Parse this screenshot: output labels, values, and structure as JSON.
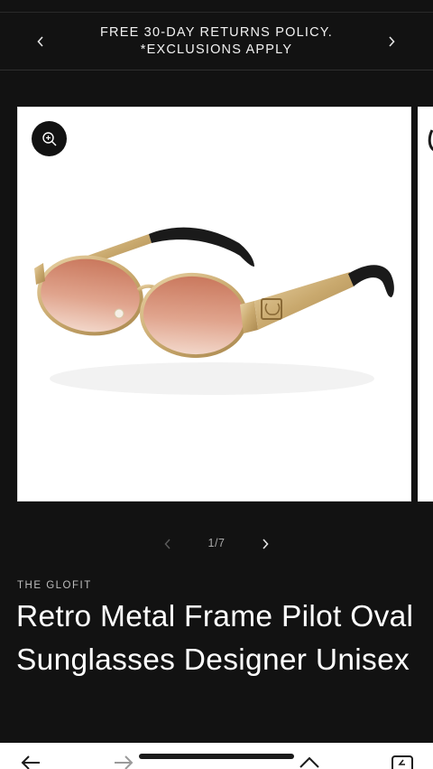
{
  "announcement": {
    "text": "FREE 30-DAY RETURNS POLICY. *EXCLUSIONS APPLY",
    "prev_icon": "chevron-left-icon",
    "next_icon": "chevron-right-icon"
  },
  "gallery": {
    "zoom_icon": "zoom-in-icon",
    "image": "sunglasses-product-photo"
  },
  "slider": {
    "counter": "1/7"
  },
  "product": {
    "vendor": "THE GLOFIT",
    "title": "Retro Metal Frame Pilot Oval Sunglasses Designer Unisex"
  },
  "browser_bar": {
    "icons": [
      "back-arrow-icon",
      "forward-arrow-icon",
      "home-icon",
      "tabs-icon"
    ]
  },
  "colors": {
    "background": "#121212",
    "lens": "#d98a6e",
    "frame_gold": "#c9a96e"
  }
}
